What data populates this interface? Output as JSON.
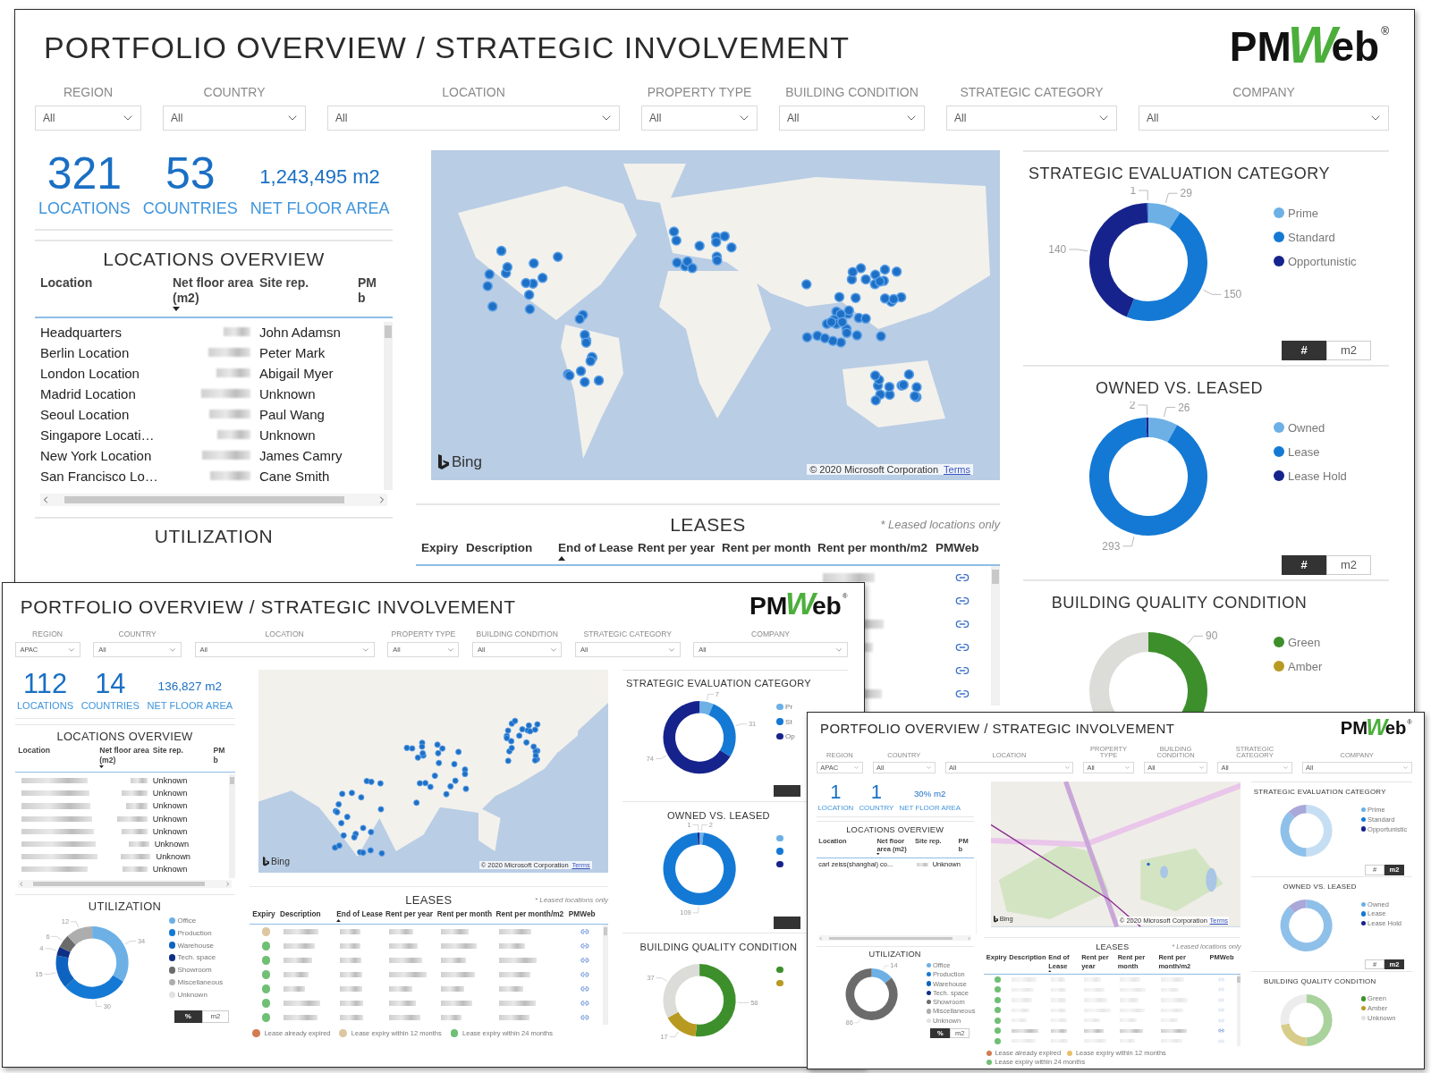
{
  "windows": [
    {
      "title": "PORTFOLIO OVERVIEW / STRATEGIC INVOLVEMENT",
      "logo": "PMWeb",
      "logo_mark": "®",
      "filters": [
        {
          "label": "REGION",
          "value": "All"
        },
        {
          "label": "COUNTRY",
          "value": "All"
        },
        {
          "label": "LOCATION",
          "value": "All"
        },
        {
          "label": "PROPERTY TYPE",
          "value": "All"
        },
        {
          "label": "BUILDING CONDITION",
          "value": "All"
        },
        {
          "label": "STRATEGIC CATEGORY",
          "value": "All"
        },
        {
          "label": "COMPANY",
          "value": "All"
        }
      ],
      "kpis": [
        {
          "value": "321",
          "label": "LOCATIONS"
        },
        {
          "value": "53",
          "label": "COUNTRIES"
        },
        {
          "value": "1,243,495 m2",
          "label": "NET FLOOR AREA"
        }
      ],
      "locations": {
        "title": "LOCATIONS OVERVIEW",
        "columns": [
          {
            "label": "Location"
          },
          {
            "label": "Net floor area (m2)",
            "sort_desc": true
          },
          {
            "label": "Site rep."
          },
          {
            "label": "PM b"
          }
        ],
        "rows": [
          {
            "location": "Headquarters",
            "site_rep": "John Adamsn"
          },
          {
            "location": "Berlin Location",
            "site_rep": "Peter Mark"
          },
          {
            "location": "London Location",
            "site_rep": "Abigail Myer"
          },
          {
            "location": "Madrid Location",
            "site_rep": "Unknown"
          },
          {
            "location": "Seoul Location",
            "site_rep": "Paul Wang"
          },
          {
            "location": "Singapore Locati…",
            "site_rep": "Unknown"
          },
          {
            "location": "New York Location",
            "site_rep": "James Camry"
          },
          {
            "location": "San Francisco Lo…",
            "site_rep": "Cane Smith"
          }
        ]
      },
      "utilization": {
        "title": "UTILIZATION"
      },
      "map": {
        "kind": "world",
        "logo": "Bing",
        "attribution": "© 2020 Microsoft Corporation",
        "terms": "Terms"
      },
      "leases": {
        "title": "LEASES",
        "note": "* Leased locations only",
        "columns": [
          {
            "label": "Expiry"
          },
          {
            "label": "Description"
          },
          {
            "label": "End of Lease",
            "sort_desc": false
          },
          {
            "label": "Rent per year"
          },
          {
            "label": "Rent per month"
          },
          {
            "label": "Rent per month/m2"
          },
          {
            "label": "PMWeb"
          }
        ],
        "rows": [
          {
            "kind": "partial"
          },
          {
            "kind": "partial"
          },
          {
            "kind": "partial"
          },
          {
            "kind": "partial"
          },
          {
            "kind": "partial"
          },
          {
            "kind": "partial"
          }
        ]
      },
      "panels": [
        {
          "title": "STRATEGIC EVALUATION CATEGORY",
          "chart_data": {
            "type": "donut",
            "values": [
              29,
              150,
              140,
              1
            ],
            "colors": [
              "#6cb0e6",
              "#1479d4",
              "#17238c",
              "#4a7fd0"
            ],
            "data_labels": true
          },
          "legend": [
            {
              "label": "Prime",
              "color": "#6cb0e6"
            },
            {
              "label": "Standard",
              "color": "#1479d4"
            },
            {
              "label": "Opportunistic",
              "color": "#17238c"
            }
          ],
          "toggle": [
            {
              "label": "#",
              "selected": true
            },
            {
              "label": "m2",
              "selected": false
            }
          ]
        },
        {
          "title": "OWNED VS. LEASED",
          "chart_data": {
            "type": "donut",
            "values": [
              26,
              293,
              2
            ],
            "colors": [
              "#6cb0e6",
              "#1479d4",
              "#17238c"
            ],
            "data_labels": true
          },
          "legend": [
            {
              "label": "Owned",
              "color": "#6cb0e6"
            },
            {
              "label": "Lease",
              "color": "#1479d4"
            },
            {
              "label": "Lease Hold",
              "color": "#17238c"
            }
          ],
          "toggle": [
            {
              "label": "#",
              "selected": true
            },
            {
              "label": "m2",
              "selected": false
            }
          ]
        },
        {
          "title": "BUILDING QUALITY CONDITION",
          "donut_picture": {
            "label": "90"
          },
          "legend": [
            {
              "label": "Green",
              "color": "#3d8f2c"
            },
            {
              "label": "Amber",
              "color": "#b89a22"
            }
          ]
        }
      ]
    },
    {
      "title": "PORTFOLIO OVERVIEW / STRATEGIC INVOLVEMENT",
      "logo": "PMWeb",
      "logo_mark": "®",
      "filters": [
        {
          "label": "REGION",
          "value": "APAC"
        },
        {
          "label": "COUNTRY",
          "value": "All"
        },
        {
          "label": "LOCATION",
          "value": "All"
        },
        {
          "label": "PROPERTY TYPE",
          "value": "All"
        },
        {
          "label": "BUILDING CONDITION",
          "value": "All"
        },
        {
          "label": "STRATEGIC CATEGORY",
          "value": "All"
        },
        {
          "label": "COMPANY",
          "value": "All"
        }
      ],
      "kpis": [
        {
          "value": "112",
          "label": "LOCATIONS"
        },
        {
          "value": "14",
          "label": "COUNTRIES"
        },
        {
          "value": "136,827 m2",
          "label": "NET FLOOR AREA"
        }
      ],
      "locations": {
        "title": "LOCATIONS OVERVIEW",
        "columns": [
          {
            "label": "Location"
          },
          {
            "label": "Net floor area (m2)",
            "sort_desc": true
          },
          {
            "label": "Site rep."
          },
          {
            "label": "PM b"
          }
        ],
        "rows": [
          {
            "location_blurred": true,
            "site_rep": "Unknown"
          },
          {
            "location_blurred": true,
            "site_rep": "Unknown"
          },
          {
            "location_blurred": true,
            "site_rep": "Unknown"
          },
          {
            "location_blurred": true,
            "site_rep": "Unknown"
          },
          {
            "location_blurred": true,
            "site_rep": "Unknown"
          },
          {
            "location_blurred": true,
            "site_rep": "Unknown"
          },
          {
            "location_blurred": true,
            "site_rep": "Unknown"
          },
          {
            "location_blurred": true,
            "site_rep": "Unknown"
          }
        ]
      },
      "utilization": {
        "title": "UTILIZATION",
        "chart_data": {
          "type": "donut",
          "values": [
            34,
            30,
            15,
            4,
            6,
            12
          ],
          "colors": [
            "#6cb0e6",
            "#1479d4",
            "#0f63c0",
            "#0e2f86",
            "#6b6b6b",
            "#adadad"
          ],
          "data_labels": true
        },
        "legend": [
          {
            "label": "Office",
            "color": "#6cb0e6"
          },
          {
            "label": "Production",
            "color": "#1479d4"
          },
          {
            "label": "Warehouse",
            "color": "#0f63c0"
          },
          {
            "label": "Tech. space",
            "color": "#0e2f86"
          },
          {
            "label": "Showroom",
            "color": "#6b6b6b"
          },
          {
            "label": "Miscellaneous",
            "color": "#adadad"
          },
          {
            "label": "Unknown",
            "color": "#e2e2e2"
          }
        ],
        "toggle": [
          {
            "label": "%",
            "selected": true
          },
          {
            "label": "m2",
            "selected": false
          }
        ]
      },
      "map": {
        "kind": "asia",
        "logo": "Bing",
        "attribution": "© 2020 Microsoft Corporation",
        "terms": "Terms"
      },
      "leases": {
        "title": "LEASES",
        "note": "* Leased locations only",
        "columns": [
          {
            "label": "Expiry"
          },
          {
            "label": "Description"
          },
          {
            "label": "End of Lease",
            "sort_desc": false
          },
          {
            "label": "Rent per year"
          },
          {
            "label": "Rent per month"
          },
          {
            "label": "Rent per month/m2"
          },
          {
            "label": "PMWeb"
          }
        ],
        "rows": [
          {
            "kind": "full",
            "color": "#dcc7a2"
          },
          {
            "kind": "full",
            "color": "#6fbf74"
          },
          {
            "kind": "full",
            "color": "#6fbf74"
          },
          {
            "kind": "full",
            "color": "#6fbf74"
          },
          {
            "kind": "full",
            "color": "#6fbf74"
          },
          {
            "kind": "full",
            "color": "#6fbf74"
          },
          {
            "kind": "full",
            "color": "#6fbf74"
          }
        ],
        "legend": [
          {
            "label": "Lease already expired",
            "color": "#d27c52"
          },
          {
            "label": "Lease expiry within 12 months",
            "color": "#dcc7a2"
          },
          {
            "label": "Lease expiry within 24 months",
            "color": "#6fbf74"
          }
        ]
      },
      "panels": [
        {
          "title": "STRATEGIC EVALUATION CATEGORY",
          "chart_data": {
            "type": "donut",
            "values": [
              7,
              31,
              74
            ],
            "colors": [
              "#6cb0e6",
              "#1479d4",
              "#17238c"
            ],
            "data_labels": true
          },
          "legend": [
            {
              "label": "Pr",
              "color": "#6cb0e6"
            },
            {
              "label": "St",
              "color": "#1479d4"
            },
            {
              "label": "Op",
              "color": "#17238c"
            }
          ],
          "toggle": [
            {
              "selected": true
            }
          ]
        },
        {
          "title": "OWNED VS. LEASED",
          "chart_data": {
            "type": "donut",
            "values": [
              2,
              109,
              1
            ],
            "colors": [
              "#6cb0e6",
              "#1479d4",
              "#17238c"
            ],
            "data_labels": true
          },
          "legend": [
            {
              "color": "#6cb0e6"
            },
            {
              "color": "#1479d4"
            },
            {
              "color": "#17238c"
            }
          ],
          "toggle": [
            {
              "selected": true
            }
          ]
        },
        {
          "title": "BUILDING QUALITY CONDITION",
          "chart_data": {
            "type": "donut",
            "values": [
              58,
              17,
              37
            ],
            "colors": [
              "#3d8f2c",
              "#b89a22",
              "#dcdcd8"
            ],
            "data_labels": true
          },
          "legend": [
            {
              "color": "#3d8f2c"
            },
            {
              "color": "#b89a22"
            }
          ]
        }
      ]
    },
    {
      "title": "PORTFOLIO OVERVIEW / STRATEGIC INVOLVEMENT",
      "logo": "PMWeb",
      "logo_mark": "®",
      "filters": [
        {
          "label": "REGION",
          "value": "APAC"
        },
        {
          "label": "COUNTRY",
          "value": "All"
        },
        {
          "label": "LOCATION",
          "value": "All"
        },
        {
          "label": "PROPERTY TYPE",
          "value": "All"
        },
        {
          "label": "BUILDING CONDITION",
          "value": "All"
        },
        {
          "label": "STRATEGIC CATEGORY",
          "value": "All"
        },
        {
          "label": "COMPANY",
          "value": "All"
        }
      ],
      "kpis": [
        {
          "value": "1",
          "label": "LOCATION"
        },
        {
          "value": "1",
          "label": "COUNTRY"
        },
        {
          "value": "30% m2",
          "label": "NET FLOOR AREA"
        }
      ],
      "locations": {
        "title": "LOCATIONS OVERVIEW",
        "columns": [
          {
            "label": "Location"
          },
          {
            "label": "Net floor area (m2)",
            "sort_desc": true
          },
          {
            "label": "Site rep."
          },
          {
            "label": "PM b"
          }
        ],
        "rows": [
          {
            "location": "carl zeiss(shanghai) co...",
            "site_rep": "Unknown"
          }
        ]
      },
      "utilization": {
        "title": "UTILIZATION",
        "chart_data": {
          "type": "donut",
          "values": [
            14,
            86
          ],
          "colors": [
            "#6cb0e6",
            "#6b6b6b"
          ],
          "data_labels": true
        },
        "legend": [
          {
            "label": "Office",
            "color": "#6cb0e6"
          },
          {
            "label": "Production",
            "color": "#1479d4"
          },
          {
            "label": "Warehouse",
            "color": "#0f63c0"
          },
          {
            "label": "Tech. space",
            "color": "#0e2f86"
          },
          {
            "label": "Showroom",
            "color": "#6b6b6b"
          },
          {
            "label": "Miscellaneous",
            "color": "#adadad"
          },
          {
            "label": "Unknown",
            "color": "#e2e2e2"
          }
        ],
        "toggle": [
          {
            "label": "%",
            "selected": true
          },
          {
            "label": "m2",
            "selected": false
          }
        ]
      },
      "map": {
        "kind": "street",
        "logo": "Bing",
        "attribution": "© 2020 Microsoft Corporation",
        "terms": "Terms"
      },
      "leases": {
        "title": "LEASES",
        "note": "* Leased locations only",
        "columns": [
          {
            "label": "Expiry"
          },
          {
            "label": "Description"
          },
          {
            "label": "End of Lease",
            "sort_desc": false
          },
          {
            "label": "Rent per year"
          },
          {
            "label": "Rent per month"
          },
          {
            "label": "Rent per month/m2"
          },
          {
            "label": "PMWeb"
          }
        ],
        "rows": [
          {
            "kind": "full",
            "color": "#6fbf74",
            "dimmed": true
          },
          {
            "kind": "full",
            "color": "#6fbf74",
            "dimmed": true
          },
          {
            "kind": "full",
            "color": "#6fbf74",
            "dimmed": true
          },
          {
            "kind": "full",
            "color": "#6fbf74",
            "dimmed": true
          },
          {
            "kind": "full",
            "color": "#6fbf74",
            "dimmed": true
          },
          {
            "kind": "full",
            "color": "#6fbf74",
            "dimmed": false
          },
          {
            "kind": "full",
            "color": "#6fbf74",
            "dimmed": true
          }
        ],
        "legend": [
          {
            "label": "Lease already expired",
            "color": "#d27c52"
          },
          {
            "label": "Lease expiry within 12 months",
            "color": "#e8c06a"
          },
          {
            "label": "Lease expiry within 24 months",
            "color": "#6fbf74"
          }
        ]
      },
      "panels": [
        {
          "title": "STRATEGIC EVALUATION CATEGORY",
          "chart_data": {
            "type": "donut",
            "values": [
              50,
              38,
              12
            ],
            "colors": [
              "#c6def3",
              "#8ec0ea",
              "#a9a8d9"
            ]
          },
          "legend": [
            {
              "label": "Prime",
              "color": "#6cb0e6"
            },
            {
              "label": "Standard",
              "color": "#1479d4"
            },
            {
              "label": "Opportunistic",
              "color": "#17238c"
            }
          ],
          "toggle": [
            {
              "label": "#",
              "selected": false
            },
            {
              "label": "m2",
              "selected": true
            }
          ]
        },
        {
          "title": "OWNED VS. LEASED",
          "chart_data": {
            "type": "donut",
            "values": [
              88,
              12
            ],
            "colors": [
              "#8ec0ea",
              "#a9a8d9"
            ]
          },
          "legend": [
            {
              "label": "Owned",
              "color": "#6cb0e6"
            },
            {
              "label": "Lease",
              "color": "#1479d4"
            },
            {
              "label": "Lease Hold",
              "color": "#17238c"
            }
          ],
          "toggle": [
            {
              "label": "#",
              "selected": false
            },
            {
              "label": "m2",
              "selected": true
            }
          ]
        },
        {
          "title": "BUILDING QUALITY CONDITION",
          "chart_data": {
            "type": "donut",
            "values": [
              50,
              22,
              28
            ],
            "colors": [
              "#a9d29c",
              "#d8cc8a",
              "#ececec"
            ]
          },
          "legend": [
            {
              "label": "Green",
              "color": "#3d8f2c"
            },
            {
              "label": "Amber",
              "color": "#b89a22"
            },
            {
              "label": "Unknown",
              "color": "#e2e2e2"
            }
          ]
        }
      ]
    }
  ]
}
